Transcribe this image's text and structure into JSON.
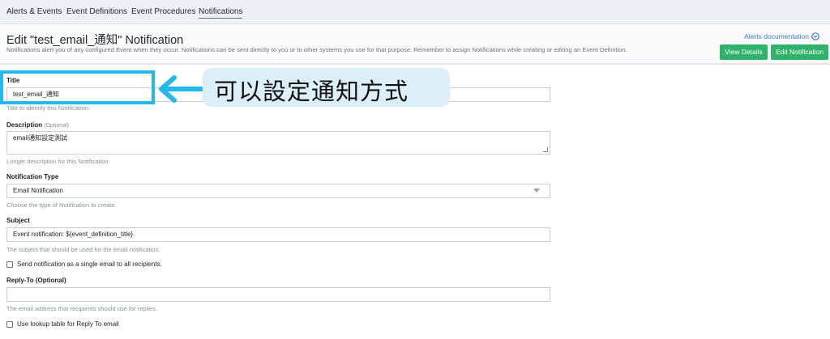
{
  "tabs": [
    {
      "label": "Alerts & Events"
    },
    {
      "label": "Event Definitions"
    },
    {
      "label": "Event Procedures"
    },
    {
      "label": "Notifications"
    }
  ],
  "header": {
    "title": "Edit \"test_email_通知\" Notification",
    "description": "Notifications alert you of any configured Event when they occur. Notifications can be sent directly to you or to other systems you use for that purpose. Remember to assign Notifications while creating or editing an Event Definition.",
    "docs_link": "Alerts documentation",
    "view_details": "View Details",
    "edit_notification": "Edit Notification"
  },
  "form": {
    "title": {
      "label": "Title",
      "value": "test_email_通知",
      "help": "Title to identify this Notification."
    },
    "description": {
      "label": "Description",
      "optional": "(Optional)",
      "value": "email通知設定測試",
      "help": "Longer description for this Notification."
    },
    "type": {
      "label": "Notification Type",
      "value": "Email Notification",
      "help": "Choose the type of Notification to create."
    },
    "subject": {
      "label": "Subject",
      "value": "Event notification: ${event_definition_title}",
      "help": "The subject that should be used for the email notification."
    },
    "single_email": {
      "label": "Send notification as a single email to all recipients."
    },
    "reply_to": {
      "label": "Reply-To (Optional)",
      "value": "",
      "help": "The email address that recipients should use for replies."
    },
    "lookup": {
      "label": "Use lookup table for Reply To email"
    }
  },
  "annotation": {
    "text": "可以設定通知方式",
    "color": "#24b8ef"
  }
}
